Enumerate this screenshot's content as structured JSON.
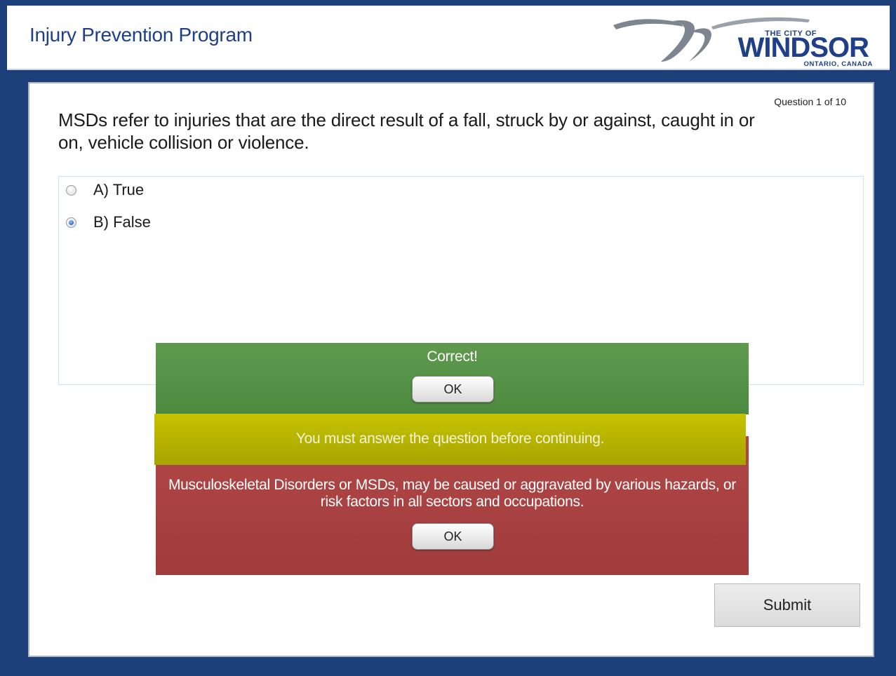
{
  "header": {
    "title": "Injury Prevention Program",
    "logo": {
      "top_text": "THE CITY OF",
      "name": "WINDSOR",
      "sub_text": "ONTARIO, CANADA"
    }
  },
  "quiz": {
    "question_counter": "Question 1 of 10",
    "question": "MSDs refer to injuries that are the direct result of a fall, struck by or against, caught in or on, vehicle collision or violence.",
    "options": [
      {
        "label": "A) True",
        "selected": false
      },
      {
        "label": "B) False",
        "selected": true
      }
    ],
    "submit_label": "Submit"
  },
  "feedback": {
    "correct": {
      "message": "Correct!",
      "ok_label": "OK"
    },
    "warning": {
      "message": "You must answer the question before continuing."
    },
    "incorrect": {
      "message": "Musculoskeletal Disorders or MSDs, may be caused or aggravated by various hazards, or risk factors in all sectors and occupations.",
      "ok_label": "OK"
    }
  },
  "colors": {
    "background": "#1c3f7a",
    "title": "#1f3f8a",
    "correct": "#56944a",
    "warning": "#b8b500",
    "incorrect": "#a94141"
  }
}
